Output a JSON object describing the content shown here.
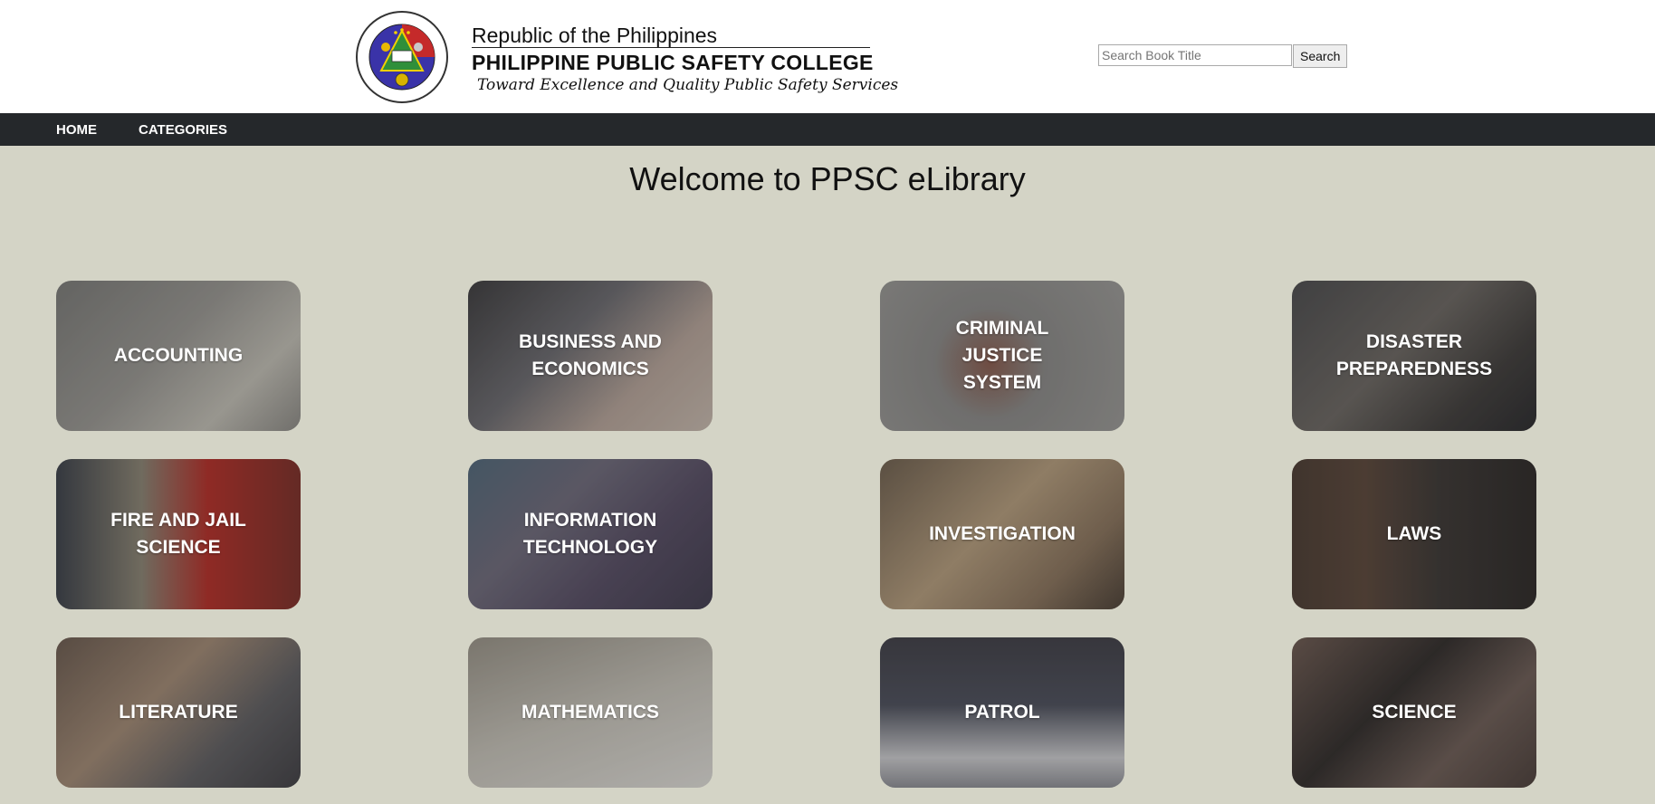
{
  "header": {
    "logo_text": "PHILIPPINE PUBLIC SAFETY COLLEGE",
    "line1": "Republic of the Philippines",
    "line2": "PHILIPPINE PUBLIC SAFETY COLLEGE",
    "tagline": "Toward Excellence and Quality Public Safety Services"
  },
  "search": {
    "placeholder": "Search Book Title",
    "button_label": "Search"
  },
  "nav": {
    "home": "HOME",
    "categories": "CATEGORIES"
  },
  "main": {
    "title": "Welcome to PPSC eLibrary",
    "categories": [
      {
        "label": "ACCOUNTING",
        "icon": "calculator-icon"
      },
      {
        "label": "BUSINESS AND ECONOMICS",
        "icon": "laptop-icon"
      },
      {
        "label": "CRIMINAL JUSTICE SYSTEM",
        "icon": "gavel-icon"
      },
      {
        "label": "DISASTER PREPAREDNESS",
        "icon": "firefighter-icon"
      },
      {
        "label": "FIRE AND JAIL SCIENCE",
        "icon": "fire-alarm-icon"
      },
      {
        "label": "INFORMATION TECHNOLOGY",
        "icon": "computer-icon"
      },
      {
        "label": "INVESTIGATION",
        "icon": "magnifier-icon"
      },
      {
        "label": "LAWS",
        "icon": "law-books-icon"
      },
      {
        "label": "LITERATURE",
        "icon": "bookshelf-icon"
      },
      {
        "label": "MATHEMATICS",
        "icon": "notebook-icon"
      },
      {
        "label": "PATROL",
        "icon": "police-car-icon"
      },
      {
        "label": "SCIENCE",
        "icon": "microscope-icon"
      }
    ]
  },
  "colors": {
    "background": "#d4d4c6",
    "navbar": "#25282b",
    "header": "#ffffff"
  }
}
